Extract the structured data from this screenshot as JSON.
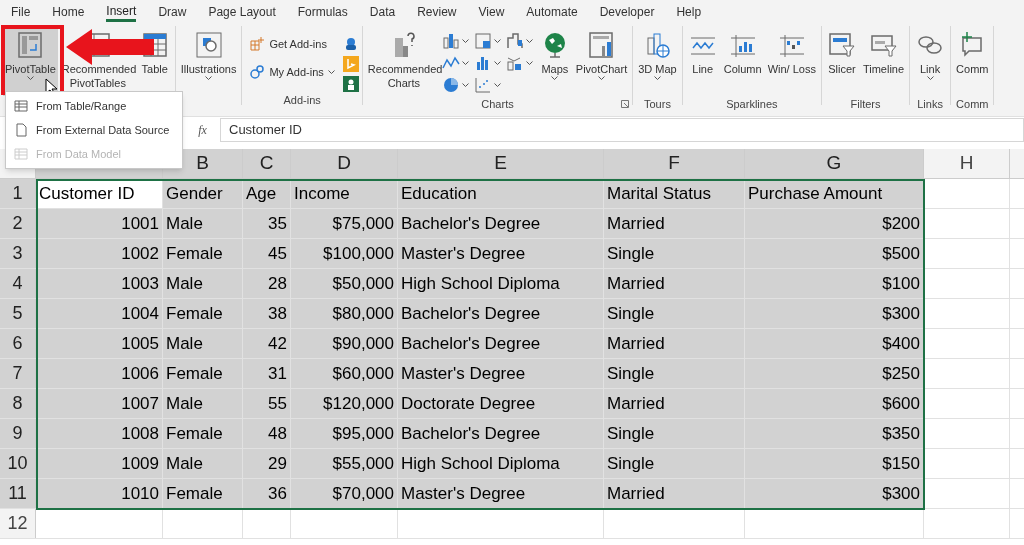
{
  "menu_tabs": [
    {
      "label": "File",
      "selected": false
    },
    {
      "label": "Home",
      "selected": false
    },
    {
      "label": "Insert",
      "selected": true
    },
    {
      "label": "Draw",
      "selected": false
    },
    {
      "label": "Page Layout",
      "selected": false
    },
    {
      "label": "Formulas",
      "selected": false
    },
    {
      "label": "Data",
      "selected": false
    },
    {
      "label": "Review",
      "selected": false
    },
    {
      "label": "View",
      "selected": false
    },
    {
      "label": "Automate",
      "selected": false
    },
    {
      "label": "Developer",
      "selected": false
    },
    {
      "label": "Help",
      "selected": false
    }
  ],
  "ribbon": [
    {
      "buttons": [
        {
          "label": "PivotTable",
          "dropdown": true,
          "selected": true
        },
        {
          "label": "Recommended PivotTables",
          "dropdown": false,
          "selected": false
        },
        {
          "label": "Table",
          "dropdown": false,
          "selected": false
        }
      ]
    },
    {
      "buttons": [
        {
          "label": "Illustrations",
          "dropdown": true,
          "selected": false
        }
      ]
    },
    {
      "label": "Add-ins",
      "kind": "addins",
      "buttons": [
        {
          "label": "Get Add-ins",
          "dropdown": false,
          "selected": false
        },
        {
          "label": "My Add-ins",
          "dropdown": true,
          "selected": false
        }
      ]
    },
    {
      "label": "Charts",
      "kind": "charts",
      "launcher": true,
      "buttons": [
        {
          "label": "Recommended Charts",
          "dropdown": false,
          "selected": false
        },
        {
          "label": "Maps",
          "dropdown": true,
          "selected": false
        },
        {
          "label": "PivotChart",
          "dropdown": true,
          "selected": false
        }
      ]
    },
    {
      "label": "Tours",
      "buttons": [
        {
          "label": "3D Map",
          "dropdown": true,
          "selected": false
        }
      ]
    },
    {
      "label": "Sparklines",
      "buttons": [
        {
          "label": "Line",
          "dropdown": false,
          "selected": false
        },
        {
          "label": "Column",
          "dropdown": false,
          "selected": false
        },
        {
          "label": "Win/ Loss",
          "dropdown": false,
          "selected": false
        }
      ]
    },
    {
      "label": "Filters",
      "buttons": [
        {
          "label": "Slicer",
          "dropdown": false,
          "selected": false
        },
        {
          "label": "Timeline",
          "dropdown": false,
          "selected": false
        }
      ]
    },
    {
      "label": "Links",
      "buttons": [
        {
          "label": "Link",
          "dropdown": true,
          "selected": false
        }
      ]
    },
    {
      "label": "Comm",
      "buttons": [
        {
          "label": "Comm",
          "dropdown": false,
          "selected": false
        }
      ]
    }
  ],
  "pivot_menu": [
    {
      "label": "From Table/Range",
      "disabled": false
    },
    {
      "label": "From External Data Source",
      "disabled": false
    },
    {
      "label": "From Data Model",
      "disabled": true
    }
  ],
  "formula_bar": {
    "fx": "fx",
    "value": "Customer ID"
  },
  "sheet": {
    "columns": [
      {
        "selected": true
      },
      {
        "label": "B",
        "selected": true
      },
      {
        "label": "C",
        "selected": true
      },
      {
        "label": "D",
        "selected": true
      },
      {
        "label": "E",
        "selected": true
      },
      {
        "label": "F",
        "selected": true
      },
      {
        "label": "G",
        "selected": true
      },
      {
        "label": "H",
        "selected": false
      }
    ],
    "rows": [
      {
        "num": "1",
        "selected": true,
        "cells": [
          {
            "text": "Customer ID",
            "right_aligned": false
          },
          {
            "text": "Gender",
            "right_aligned": false
          },
          {
            "text": "Age",
            "right_aligned": false
          },
          {
            "text": "Income",
            "right_aligned": false
          },
          {
            "text": "Education",
            "right_aligned": false
          },
          {
            "text": "Marital Status",
            "right_aligned": false
          },
          {
            "text": "Purchase Amount",
            "right_aligned": false
          }
        ]
      },
      {
        "num": "2",
        "selected": true,
        "cells": [
          {
            "text": "1001",
            "right_aligned": true
          },
          {
            "text": "Male",
            "right_aligned": false
          },
          {
            "text": "35",
            "right_aligned": true
          },
          {
            "text": "$75,000",
            "right_aligned": true
          },
          {
            "text": "Bachelor's Degree",
            "right_aligned": false
          },
          {
            "text": "Married",
            "right_aligned": false
          },
          {
            "text": "$200",
            "right_aligned": true
          }
        ]
      },
      {
        "num": "3",
        "selected": true,
        "cells": [
          {
            "text": "1002",
            "right_aligned": true
          },
          {
            "text": "Female",
            "right_aligned": false
          },
          {
            "text": "45",
            "right_aligned": true
          },
          {
            "text": "$100,000",
            "right_aligned": true
          },
          {
            "text": "Master's Degree",
            "right_aligned": false
          },
          {
            "text": "Single",
            "right_aligned": false
          },
          {
            "text": "$500",
            "right_aligned": true
          }
        ]
      },
      {
        "num": "4",
        "selected": true,
        "cells": [
          {
            "text": "1003",
            "right_aligned": true
          },
          {
            "text": "Male",
            "right_aligned": false
          },
          {
            "text": "28",
            "right_aligned": true
          },
          {
            "text": "$50,000",
            "right_aligned": true
          },
          {
            "text": "High School Diploma",
            "right_aligned": false
          },
          {
            "text": "Married",
            "right_aligned": false
          },
          {
            "text": "$100",
            "right_aligned": true
          }
        ]
      },
      {
        "num": "5",
        "selected": true,
        "cells": [
          {
            "text": "1004",
            "right_aligned": true
          },
          {
            "text": "Female",
            "right_aligned": false
          },
          {
            "text": "38",
            "right_aligned": true
          },
          {
            "text": "$80,000",
            "right_aligned": true
          },
          {
            "text": "Bachelor's Degree",
            "right_aligned": false
          },
          {
            "text": "Single",
            "right_aligned": false
          },
          {
            "text": "$300",
            "right_aligned": true
          }
        ]
      },
      {
        "num": "6",
        "selected": true,
        "cells": [
          {
            "text": "1005",
            "right_aligned": true
          },
          {
            "text": "Male",
            "right_aligned": false
          },
          {
            "text": "42",
            "right_aligned": true
          },
          {
            "text": "$90,000",
            "right_aligned": true
          },
          {
            "text": "Bachelor's Degree",
            "right_aligned": false
          },
          {
            "text": "Married",
            "right_aligned": false
          },
          {
            "text": "$400",
            "right_aligned": true
          }
        ]
      },
      {
        "num": "7",
        "selected": true,
        "cells": [
          {
            "text": "1006",
            "right_aligned": true
          },
          {
            "text": "Female",
            "right_aligned": false
          },
          {
            "text": "31",
            "right_aligned": true
          },
          {
            "text": "$60,000",
            "right_aligned": true
          },
          {
            "text": "Master's Degree",
            "right_aligned": false
          },
          {
            "text": "Single",
            "right_aligned": false
          },
          {
            "text": "$250",
            "right_aligned": true
          }
        ]
      },
      {
        "num": "8",
        "selected": true,
        "cells": [
          {
            "text": "1007",
            "right_aligned": true
          },
          {
            "text": "Male",
            "right_aligned": false
          },
          {
            "text": "55",
            "right_aligned": true
          },
          {
            "text": "$120,000",
            "right_aligned": true
          },
          {
            "text": "Doctorate Degree",
            "right_aligned": false
          },
          {
            "text": "Married",
            "right_aligned": false
          },
          {
            "text": "$600",
            "right_aligned": true
          }
        ]
      },
      {
        "num": "9",
        "selected": true,
        "cells": [
          {
            "text": "1008",
            "right_aligned": true
          },
          {
            "text": "Female",
            "right_aligned": false
          },
          {
            "text": "48",
            "right_aligned": true
          },
          {
            "text": "$95,000",
            "right_aligned": true
          },
          {
            "text": "Bachelor's Degree",
            "right_aligned": false
          },
          {
            "text": "Single",
            "right_aligned": false
          },
          {
            "text": "$350",
            "right_aligned": true
          }
        ]
      },
      {
        "num": "10",
        "selected": true,
        "cells": [
          {
            "text": "1009",
            "right_aligned": true
          },
          {
            "text": "Male",
            "right_aligned": false
          },
          {
            "text": "29",
            "right_aligned": true
          },
          {
            "text": "$55,000",
            "right_aligned": true
          },
          {
            "text": "High School Diploma",
            "right_aligned": false
          },
          {
            "text": "Single",
            "right_aligned": false
          },
          {
            "text": "$150",
            "right_aligned": true
          }
        ]
      },
      {
        "num": "11",
        "selected": true,
        "cells": [
          {
            "text": "1010",
            "right_aligned": true
          },
          {
            "text": "Female",
            "right_aligned": false
          },
          {
            "text": "36",
            "right_aligned": true
          },
          {
            "text": "$70,000",
            "right_aligned": true
          },
          {
            "text": "Master's Degree",
            "right_aligned": false
          },
          {
            "text": "Married",
            "right_aligned": false
          },
          {
            "text": "$300",
            "right_aligned": true
          }
        ]
      },
      {
        "num": "12",
        "selected": false,
        "cells": []
      }
    ]
  }
}
